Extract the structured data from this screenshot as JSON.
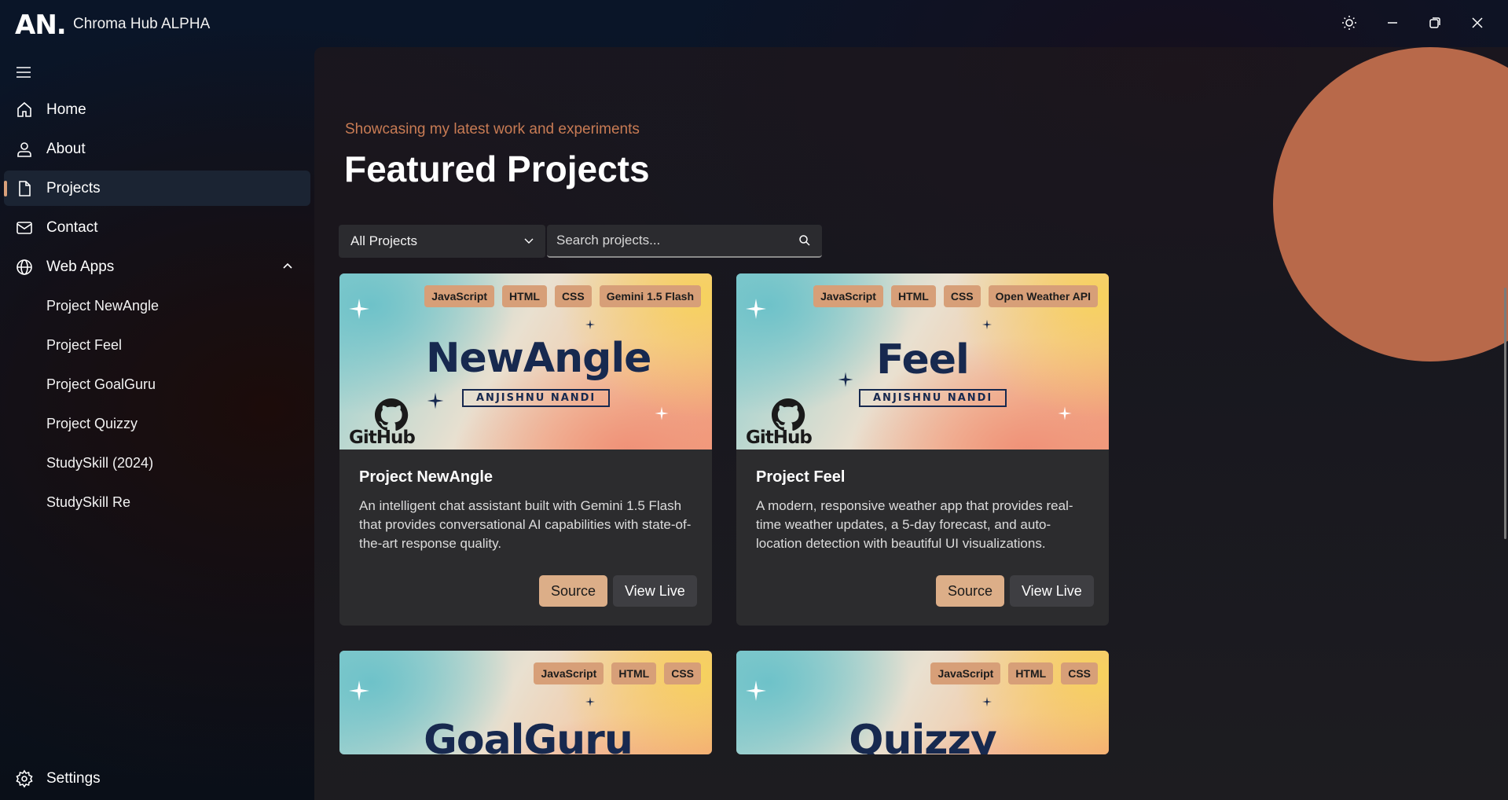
{
  "titlebar": {
    "logo": "AN.",
    "app_title": "Chroma Hub ALPHA"
  },
  "sidebar": {
    "items": [
      {
        "label": "Home",
        "icon": "home-icon"
      },
      {
        "label": "About",
        "icon": "person-icon"
      },
      {
        "label": "Projects",
        "icon": "document-icon",
        "active": true
      },
      {
        "label": "Contact",
        "icon": "mail-icon"
      },
      {
        "label": "Web Apps",
        "icon": "globe-icon",
        "expanded": true
      }
    ],
    "sub_items": [
      {
        "label": "Project NewAngle"
      },
      {
        "label": "Project Feel"
      },
      {
        "label": "Project GoalGuru"
      },
      {
        "label": "Project Quizzy"
      },
      {
        "label": "StudySkill (2024)"
      },
      {
        "label": "StudySkill Re"
      }
    ],
    "settings_label": "Settings"
  },
  "main": {
    "subtitle": "Showcasing my latest work and experiments",
    "title": "Featured Projects",
    "filter_value": "All Projects",
    "search_placeholder": "Search projects...",
    "cards": [
      {
        "banner_title": "NewAngle",
        "banner_sub": "ANJISHNU NANDI",
        "github_label": "GitHub",
        "tags": [
          "JavaScript",
          "HTML",
          "CSS",
          "Gemini 1.5 Flash"
        ],
        "title": "Project NewAngle",
        "description": "An intelligent chat assistant built with Gemini 1.5 Flash that provides conversational AI capabilities with state-of-the-art response quality.",
        "source_label": "Source",
        "live_label": "View Live"
      },
      {
        "banner_title": "Feel",
        "banner_sub": "ANJISHNU NANDI",
        "github_label": "GitHub",
        "tags": [
          "JavaScript",
          "HTML",
          "CSS",
          "Open Weather API"
        ],
        "title": "Project Feel",
        "description": "A modern, responsive weather app that provides real-time weather updates, a 5-day forecast, and auto-location detection with beautiful UI visualizations.",
        "source_label": "Source",
        "live_label": "View Live"
      },
      {
        "banner_title": "GoalGuru",
        "tags": [
          "JavaScript",
          "HTML",
          "CSS"
        ]
      },
      {
        "banner_title": "Quizzy",
        "tags": [
          "JavaScript",
          "HTML",
          "CSS"
        ]
      }
    ]
  },
  "colors": {
    "accent": "#d9a07a",
    "subtitle": "#c87b54",
    "circle": "#b8694a",
    "tag_bg": "#d79f78",
    "banner_text": "#17294f"
  }
}
